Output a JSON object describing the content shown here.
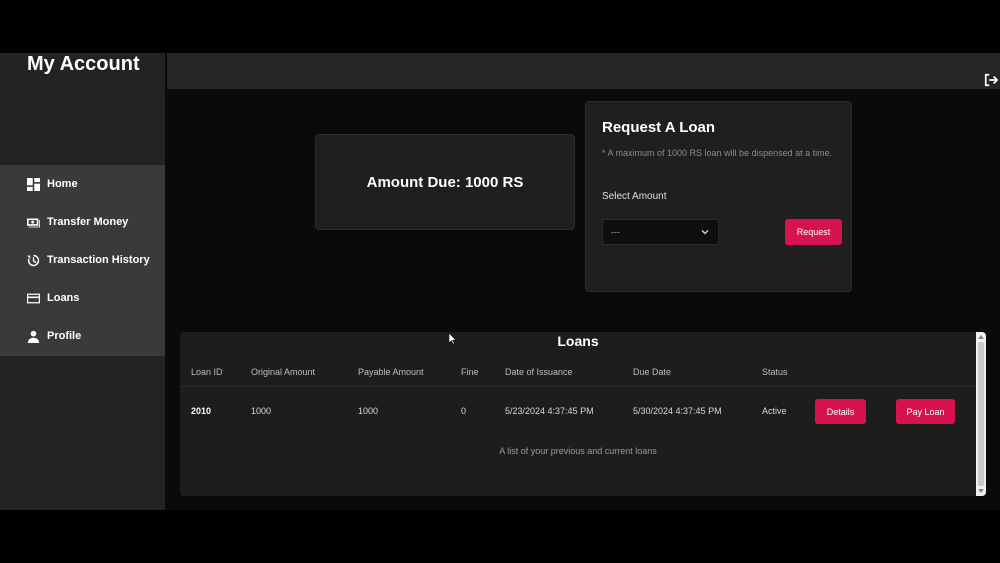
{
  "sidebar": {
    "brand": "My Account",
    "items": [
      {
        "label": "Home",
        "icon": "dashboard-icon"
      },
      {
        "label": "Transfer Money",
        "icon": "money-icon"
      },
      {
        "label": "Transaction History",
        "icon": "history-icon"
      },
      {
        "label": "Loans",
        "icon": "card-icon"
      },
      {
        "label": "Profile",
        "icon": "user-icon"
      }
    ]
  },
  "header": {
    "logout_icon": "logout-icon"
  },
  "due": {
    "text": "Amount Due: 1000 RS"
  },
  "request_loan": {
    "title": "Request A Loan",
    "note": "* A maximum of 1000 RS loan will be dispensed at a time.",
    "select_label": "Select Amount",
    "selected_value": "---",
    "button_label": "Request"
  },
  "loans": {
    "title": "Loans",
    "columns": [
      "Loan ID",
      "Original Amount",
      "Payable Amount",
      "Fine",
      "Date of Issuance",
      "Due Date",
      "Status"
    ],
    "rows": [
      {
        "loan_id": "2010",
        "original_amount": "1000",
        "payable_amount": "1000",
        "fine": "0",
        "date_of_issuance": "5/23/2024 4:37:45 PM",
        "due_date": "5/30/2024 4:37:45 PM",
        "status": "Active",
        "details_label": "Details",
        "pay_label": "Pay Loan"
      }
    ],
    "caption": "A list of your previous and current loans"
  },
  "colors": {
    "accent": "#d8114f",
    "sidebar": "#232325",
    "nav": "#3a3a3d",
    "card": "#1f1f1f"
  }
}
